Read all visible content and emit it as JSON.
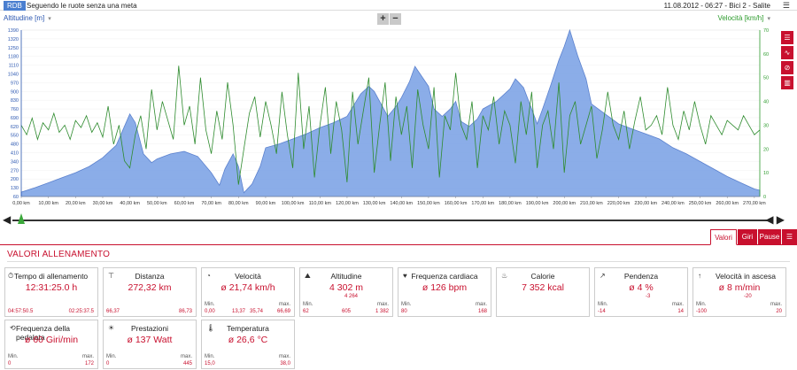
{
  "topbar": {
    "badge": "RDB",
    "title": "Seguendo le ruote senza una meta",
    "datetime": "11.08.2012  -  06:27  -  Bici 2  -  Salite",
    "menu_icon": "menu-icon"
  },
  "chart_header": {
    "left_label": "Altitudine [m]",
    "right_label": "Velocità [km/h]",
    "zoom_in": "+",
    "zoom_out": "−"
  },
  "side_tools": [
    "list-icon",
    "line-chart-icon",
    "no-entry-icon",
    "bar-chart-icon"
  ],
  "colors": {
    "altitude": "#7fa5e6",
    "speed": "#2e8b2e",
    "accent": "#c8102e"
  },
  "chart_data": {
    "type": "area",
    "xlabel": "km",
    "x_ticks": [
      "0,00 km",
      "10,00 km",
      "20,00 km",
      "30,00 km",
      "40,00 km",
      "50,00 km",
      "60,00 km",
      "70,00 km",
      "80,00 km",
      "90,00 km",
      "100,00 km",
      "110,00 km",
      "120,00 km",
      "130,00 km",
      "140,00 km",
      "150,00 km",
      "160,00 km",
      "170,00 km",
      "180,00 km",
      "190,00 km",
      "200,00 km",
      "210,00 km",
      "220,00 km",
      "230,00 km",
      "240,00 km",
      "250,00 km",
      "260,00 km",
      "270,00 km"
    ],
    "y_left_ticks": [
      "60",
      "130",
      "200",
      "270",
      "340",
      "410",
      "480",
      "550",
      "620",
      "690",
      "760",
      "830",
      "900",
      "970",
      "1040",
      "1110",
      "1180",
      "1250",
      "1320",
      "1390"
    ],
    "y_right_ticks": [
      "0",
      "10",
      "20",
      "30",
      "40",
      "50",
      "60",
      "70"
    ],
    "ylim_left": [
      60,
      1390
    ],
    "ylim_right": [
      0,
      70
    ],
    "xlim": [
      0,
      272
    ],
    "series": [
      {
        "name": "Altitudine [m]",
        "axis": "left",
        "x": [
          0,
          5,
          10,
          15,
          20,
          25,
          30,
          35,
          38,
          40,
          42,
          45,
          48,
          50,
          55,
          60,
          65,
          70,
          73,
          75,
          78,
          80,
          82,
          85,
          88,
          90,
          95,
          100,
          105,
          110,
          115,
          120,
          125,
          128,
          130,
          135,
          138,
          140,
          143,
          145,
          150,
          152,
          155,
          158,
          160,
          162,
          165,
          168,
          170,
          175,
          180,
          182,
          185,
          188,
          190,
          192,
          195,
          198,
          200,
          202,
          205,
          208,
          210,
          215,
          220,
          225,
          230,
          235,
          240,
          245,
          250,
          255,
          260,
          265,
          270,
          272
        ],
        "values": [
          95,
          130,
          170,
          210,
          250,
          300,
          370,
          470,
          620,
          720,
          650,
          400,
          330,
          360,
          400,
          420,
          380,
          250,
          150,
          280,
          400,
          300,
          90,
          160,
          300,
          450,
          480,
          520,
          560,
          610,
          650,
          700,
          880,
          940,
          900,
          700,
          780,
          850,
          980,
          1100,
          940,
          760,
          700,
          760,
          820,
          660,
          620,
          680,
          760,
          820,
          920,
          1000,
          930,
          760,
          640,
          760,
          950,
          1150,
          1260,
          1390,
          1180,
          1000,
          800,
          720,
          640,
          600,
          560,
          520,
          450,
          400,
          340,
          280,
          220,
          170,
          120,
          110
        ]
      },
      {
        "name": "Velocità [km/h]",
        "axis": "right",
        "x": [
          0,
          2,
          4,
          6,
          8,
          10,
          12,
          14,
          16,
          18,
          20,
          22,
          24,
          26,
          28,
          30,
          32,
          34,
          36,
          38,
          40,
          42,
          44,
          46,
          48,
          50,
          52,
          54,
          56,
          58,
          60,
          62,
          64,
          66,
          68,
          70,
          72,
          74,
          76,
          78,
          80,
          82,
          84,
          86,
          88,
          90,
          92,
          94,
          96,
          98,
          100,
          102,
          104,
          106,
          108,
          110,
          112,
          114,
          116,
          118,
          120,
          122,
          124,
          126,
          128,
          130,
          132,
          134,
          136,
          138,
          140,
          142,
          144,
          146,
          148,
          150,
          152,
          154,
          156,
          158,
          160,
          162,
          164,
          166,
          168,
          170,
          172,
          174,
          176,
          178,
          180,
          182,
          184,
          186,
          188,
          190,
          192,
          194,
          196,
          198,
          200,
          202,
          204,
          206,
          208,
          210,
          212,
          214,
          216,
          218,
          220,
          222,
          224,
          226,
          228,
          230,
          232,
          234,
          236,
          238,
          240,
          242,
          244,
          246,
          248,
          250,
          252,
          254,
          256,
          258,
          260,
          262,
          264,
          266,
          268,
          270,
          272
        ],
        "values": [
          30,
          26,
          33,
          24,
          31,
          28,
          35,
          27,
          30,
          24,
          32,
          29,
          34,
          27,
          31,
          25,
          38,
          22,
          30,
          15,
          12,
          26,
          34,
          20,
          45,
          28,
          40,
          32,
          24,
          55,
          30,
          38,
          22,
          50,
          28,
          18,
          36,
          24,
          48,
          30,
          5,
          20,
          35,
          42,
          25,
          40,
          30,
          18,
          44,
          26,
          12,
          52,
          20,
          38,
          8,
          30,
          46,
          18,
          40,
          28,
          6,
          44,
          22,
          36,
          50,
          10,
          30,
          48,
          15,
          42,
          26,
          38,
          12,
          45,
          30,
          20,
          46,
          8,
          34,
          28,
          52,
          30,
          24,
          40,
          12,
          34,
          28,
          42,
          22,
          36,
          30,
          14,
          40,
          26,
          44,
          12,
          30,
          36,
          20,
          48,
          10,
          34,
          40,
          22,
          30,
          38,
          16,
          28,
          44,
          30,
          24,
          36,
          20,
          32,
          42,
          28,
          30,
          34,
          26,
          46,
          30,
          24,
          36,
          28,
          40,
          30,
          22,
          34,
          30,
          26,
          32,
          30,
          28,
          34,
          30,
          26,
          28
        ]
      }
    ]
  },
  "tabs": [
    {
      "label": "Valori",
      "active": true
    },
    {
      "label": "Giri",
      "active": false
    },
    {
      "label": "Pause",
      "active": false
    }
  ],
  "section_title": "VALORI ALLENAMENTO",
  "cards": [
    {
      "title": "Tempo di allenamento",
      "icon": "clock-icon",
      "value": "12:31:25.0 h",
      "min_label": "",
      "max_label": "",
      "min": "04:57:50.5",
      "max": "02:25:37.5"
    },
    {
      "title": "Distanza",
      "icon": "road-icon",
      "value": "272,32 km",
      "min": "66,37",
      "max": "86,73"
    },
    {
      "title": "Velocità",
      "icon": "speedometer-icon",
      "value": "ø 21,74 km/h",
      "min_label": "Min.",
      "max_label": "max.",
      "min": "0,00",
      "mid1": "13,37",
      "mid2": "35,74",
      "max": "66,69"
    },
    {
      "title": "Altitudine",
      "icon": "mountain-icon",
      "value": "4 302 m",
      "sub": "4 264",
      "min_label": "Min.",
      "max_label": "max.",
      "min": "62",
      "mid": "605",
      "max": "1 382"
    },
    {
      "title": "Frequenza cardiaca",
      "icon": "heart-icon",
      "value": "ø 126 bpm",
      "min_label": "Min.",
      "max_label": "max.",
      "min": "80",
      "max": "168"
    },
    {
      "title": "Calorie",
      "icon": "flame-icon",
      "value": "7 352 kcal"
    },
    {
      "title": "Pendenza",
      "icon": "slope-icon",
      "value": "ø 4 %",
      "sub": "-3",
      "min_label": "Min.",
      "max_label": "max.",
      "min": "-14",
      "max": "14"
    },
    {
      "title": "Velocità in ascesa",
      "icon": "ascent-icon",
      "value": "ø 8 m/min",
      "sub": "-20",
      "min_label": "Min.",
      "max_label": "max.",
      "min": "-100",
      "max": "20"
    },
    {
      "title": "Frequenza della pedalata",
      "icon": "pedal-icon",
      "value": "ø 60 Giri/min",
      "min_label": "Min.",
      "max_label": "max.",
      "min": "0",
      "max": "172"
    },
    {
      "title": "Prestazioni",
      "icon": "sun-icon",
      "value": "ø 137 Watt",
      "min_label": "Min.",
      "max_label": "max.",
      "min": "0",
      "max": "445"
    },
    {
      "title": "Temperatura",
      "icon": "thermometer-icon",
      "value": "ø 26,6 °C",
      "min_label": "Min.",
      "max_label": "max.",
      "min": "15,0",
      "max": "38,0"
    }
  ]
}
